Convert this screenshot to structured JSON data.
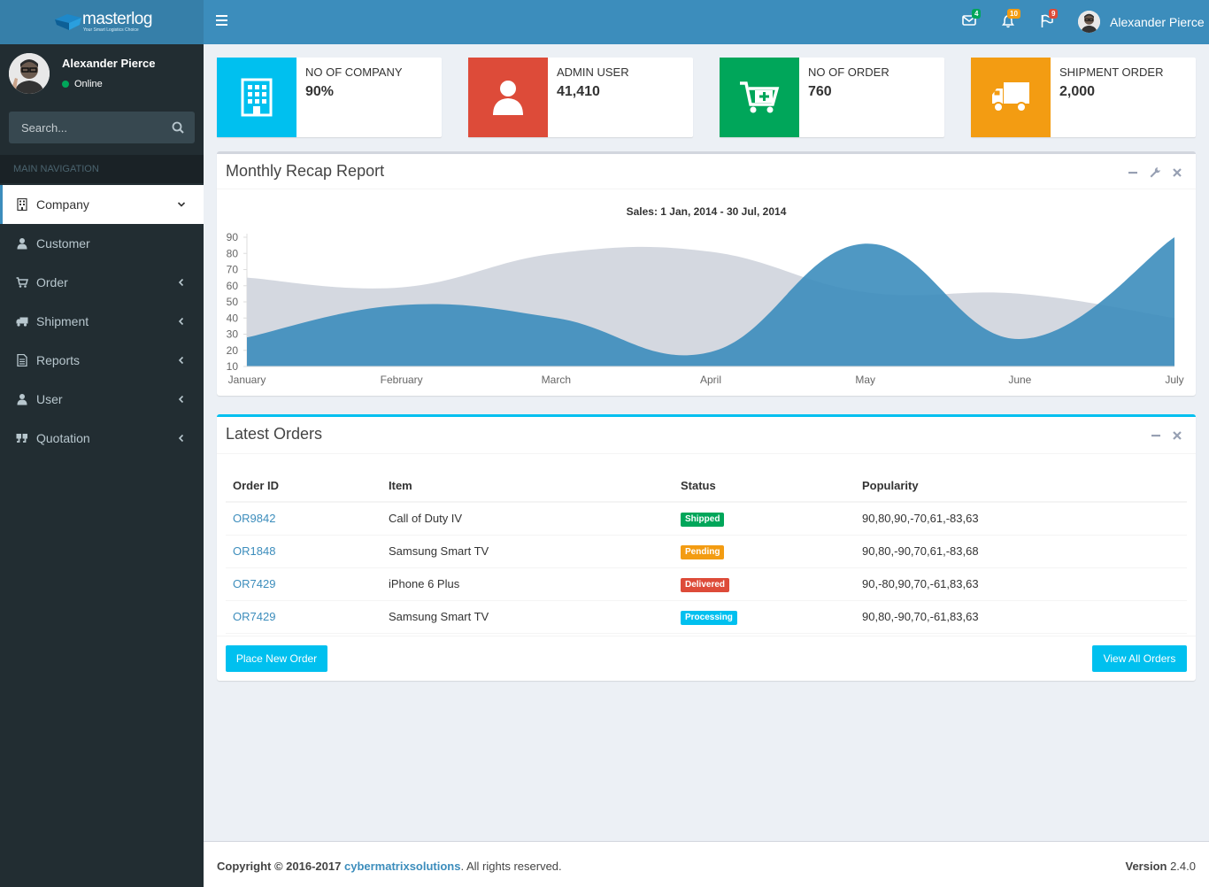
{
  "brand": {
    "name": "masterlog",
    "tagline": "Your Smart Logistics Choice"
  },
  "header": {
    "notifications": [
      {
        "name": "messages",
        "badge": "4",
        "color": "#00a65a"
      },
      {
        "name": "alerts",
        "badge": "10",
        "color": "#f39c12"
      },
      {
        "name": "tasks",
        "badge": "9",
        "color": "#dd4b39"
      }
    ],
    "user_name": "Alexander Pierce"
  },
  "sidebar": {
    "user_name": "Alexander Pierce",
    "status": "Online",
    "search_placeholder": "Search...",
    "section_header": "MAIN NAVIGATION",
    "items": [
      {
        "label": "Company",
        "icon": "building-icon",
        "active": true,
        "arrow": "down"
      },
      {
        "label": "Customer",
        "icon": "user-icon",
        "active": false,
        "arrow": ""
      },
      {
        "label": "Order",
        "icon": "cart-icon",
        "active": false,
        "arrow": "left"
      },
      {
        "label": "Shipment",
        "icon": "truck-icon",
        "active": false,
        "arrow": "left"
      },
      {
        "label": "Reports",
        "icon": "file-icon",
        "active": false,
        "arrow": "left"
      },
      {
        "label": "User",
        "icon": "user-icon",
        "active": false,
        "arrow": "left"
      },
      {
        "label": "Quotation",
        "icon": "quote-icon",
        "active": false,
        "arrow": "left"
      }
    ]
  },
  "info_boxes": [
    {
      "label": "NO OF COMPANY",
      "value": "90%",
      "color": "#00c0ef",
      "icon": "building-icon"
    },
    {
      "label": "ADMIN USER",
      "value": "41,410",
      "color": "#dd4b39",
      "icon": "user-icon"
    },
    {
      "label": "NO OF ORDER",
      "value": "760",
      "color": "#00a65a",
      "icon": "cart-plus-icon"
    },
    {
      "label": "SHIPMENT ORDER",
      "value": "2,000",
      "color": "#f39c12",
      "icon": "truck-icon"
    }
  ],
  "recap": {
    "title": "Monthly Recap Report",
    "chart_title": "Sales: 1 Jan, 2014 - 30 Jul, 2014"
  },
  "chart_data": {
    "type": "area",
    "title": "Sales: 1 Jan, 2014 - 30 Jul, 2014",
    "categories": [
      "January",
      "February",
      "March",
      "April",
      "May",
      "June",
      "July"
    ],
    "series": [
      {
        "color": "#d2d6de",
        "values": [
          65,
          59,
          80,
          81,
          56,
          55,
          40
        ]
      },
      {
        "color": "#3c8dbc",
        "values": [
          28,
          48,
          40,
          19,
          86,
          27,
          90
        ]
      }
    ],
    "ylim": [
      10,
      90
    ],
    "yticks": [
      10,
      20,
      30,
      40,
      50,
      60,
      70,
      80,
      90
    ],
    "grid": false
  },
  "orders": {
    "title": "Latest Orders",
    "columns": [
      "Order ID",
      "Item",
      "Status",
      "Popularity"
    ],
    "rows": [
      {
        "id": "OR9842",
        "item": "Call of Duty IV",
        "status": "Shipped",
        "status_color": "#00a65a",
        "popularity": "90,80,90,-70,61,-83,63"
      },
      {
        "id": "OR1848",
        "item": "Samsung Smart TV",
        "status": "Pending",
        "status_color": "#f39c12",
        "popularity": "90,80,-90,70,61,-83,68"
      },
      {
        "id": "OR7429",
        "item": "iPhone 6 Plus",
        "status": "Delivered",
        "status_color": "#dd4b39",
        "popularity": "90,-80,90,70,-61,83,63"
      },
      {
        "id": "OR7429",
        "item": "Samsung Smart TV",
        "status": "Processing",
        "status_color": "#00c0ef",
        "popularity": "90,80,-90,70,-61,83,63"
      }
    ],
    "place_btn": "Place New Order",
    "view_btn": "View All Orders"
  },
  "footer": {
    "copyright": "Copyright © 2016-2017",
    "company": "cybermatrixsolutions",
    "rights": ". All rights reserved.",
    "version_label": "Version",
    "version": "2.4.0"
  }
}
